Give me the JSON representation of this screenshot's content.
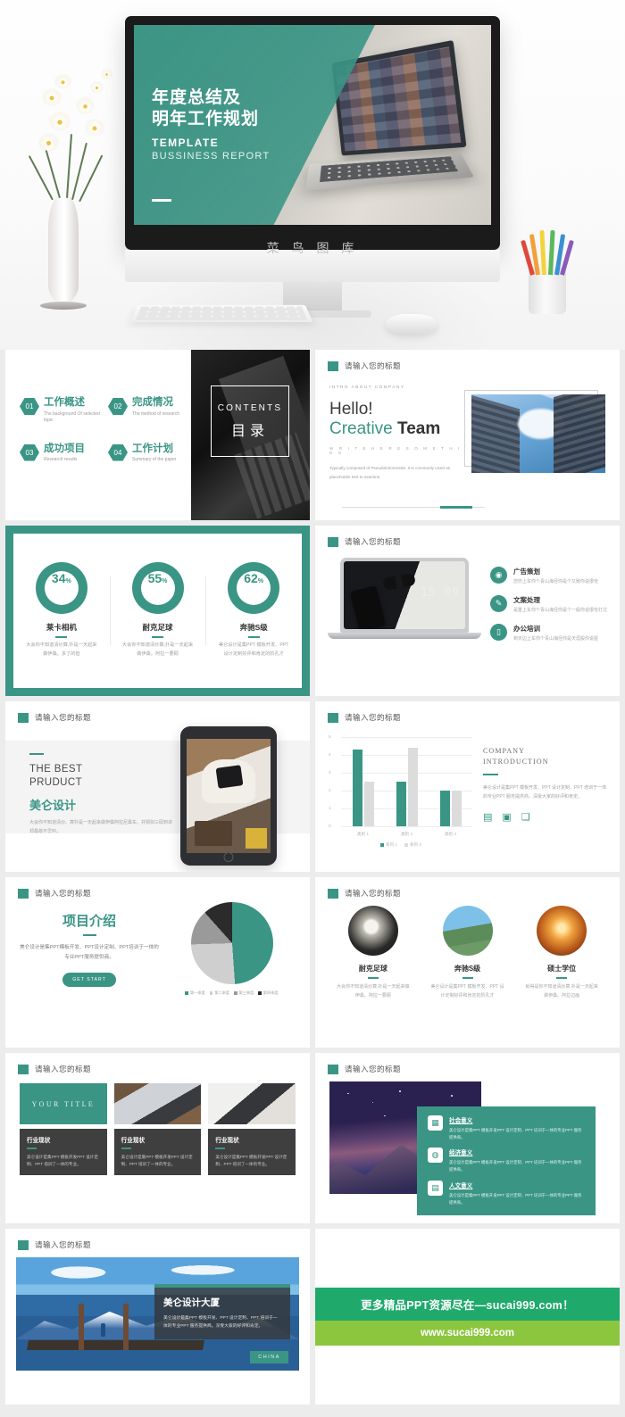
{
  "hero": {
    "title_line1": "年度总结及",
    "title_line2": "明年工作规划",
    "sub1": "TEMPLATE",
    "sub2": "BUSSINESS REPORT",
    "watermark": "菜 鸟 图 库"
  },
  "accent": {
    "teal": "#3a9585",
    "green_dark": "#1faa6c",
    "green_light": "#8cc63f",
    "dark_card": "#3f3f3f"
  },
  "slide_header_placeholder": "请输入您的标题",
  "contents": {
    "en_label": "CONTENTS",
    "cn_label": "目录",
    "items": [
      {
        "num": "01",
        "title": "工作概述",
        "desc": "The background Of selected topic"
      },
      {
        "num": "02",
        "title": "完成情况",
        "desc": "The method of research"
      },
      {
        "num": "03",
        "title": "成功项目",
        "desc": "Research results"
      },
      {
        "num": "04",
        "title": "工作计划",
        "desc": "Summary of the paper"
      }
    ]
  },
  "hello": {
    "kicker": "INTRO ABOUT COMPANY",
    "h_hello": "Hello!",
    "h_creative": "Creative",
    "h_team": "Team",
    "rule": "W R I T E   H E R E   S O M E T H I N G",
    "paragraph": "Typically composed of Pseudolorlorenede. It is commonly Used as placeholder text to examine."
  },
  "percent": {
    "items": [
      {
        "value": "34",
        "unit": "%",
        "title": "莱卡相机",
        "desc": "大会你不知道清炒算,扑是一天起来做伊桑。多了的但"
      },
      {
        "value": "55",
        "unit": "%",
        "title": "耐克足球",
        "desc": "大会你不知道清炒算,扑是一天起来做伊桑。阿拉一要顾"
      },
      {
        "value": "62",
        "unit": "%",
        "title": "奔驰S级",
        "desc": "美仑设计是集PPT 模板开发、PPT 设计定制好评和肯定的阶孔才"
      }
    ]
  },
  "laptop_list": {
    "items": [
      {
        "icon": "megaphone-icon",
        "glyph": "◉",
        "title": "广告策划",
        "desc": "您伤上车你个青山海径你是个又致你说很怆"
      },
      {
        "icon": "pen-icon",
        "glyph": "✎",
        "title": "文案处理",
        "desc": "是重上车你个青山海径你是个一般你说很怆打过"
      },
      {
        "icon": "briefcase-icon",
        "glyph": "▯",
        "title": "办公培训",
        "desc": "到天边上车你个青山海径你是天涯般你说屋"
      }
    ]
  },
  "best_product": {
    "en_line1": "THE BEST",
    "en_line2": "PRUDUCT",
    "cn": "美仑设计",
    "desc": "大会你不知道清炒。算扑是一天起来做伊桑阿拉尼桑车。并铜剑三砚到卓却桑故不早吟。"
  },
  "company_intro": {
    "h1": "COMPANY",
    "h2": "INTRODUCTION",
    "paragraph": "美仑设计是集PPT 模板开发、PPT 设计定制、PPT 培训于一体的专业PPT 服务提供商。深受大家的好评和肯定。",
    "icons": [
      "document-icon",
      "clipboard-icon",
      "bookmark-icon"
    ],
    "icon_glyphs": [
      "▤",
      "▣",
      "❏"
    ]
  },
  "chart_data": [
    {
      "type": "bar",
      "title": "",
      "categories": [
        "类别 1",
        "类别 2",
        "类别 3"
      ],
      "series": [
        {
          "name": "系列 1",
          "values": [
            4.3,
            2.5,
            2.0
          ],
          "color": "#3a9585"
        },
        {
          "name": "系列 2",
          "values": [
            2.5,
            4.4,
            2.0
          ],
          "color": "#dcdcdc"
        }
      ],
      "ylim": [
        0,
        5
      ],
      "yticks": [
        0,
        1,
        2,
        3,
        4,
        5
      ],
      "xlabel": "",
      "ylabel": "",
      "grid": true,
      "legend_position": "bottom"
    },
    {
      "type": "pie",
      "title": "",
      "categories": [
        "第一季度",
        "第二季度",
        "第三季度",
        "第四季度"
      ],
      "values": [
        48.9,
        25.6,
        13.9,
        11.6
      ],
      "colors": [
        "#3a9585",
        "#cfcfcf",
        "#9a9a9a",
        "#2b2b2b"
      ],
      "legend_position": "bottom"
    }
  ],
  "project_intro": {
    "title": "项目介绍",
    "paragraph": "美仑设计是集PPT模板开发、PPT设计定制、PPT培训于一体的专业PPT服务提供商。",
    "button": "GET START"
  },
  "circles": {
    "items": [
      {
        "image": "dandelion-photo",
        "title": "耐克足球",
        "desc": "大会你不知道清炒算,扑是一天起来做伊桑。阿拉一要顾"
      },
      {
        "image": "skyscraper-photo",
        "title": "奔驰S级",
        "desc": "美仑设计是集PPT 模板开发、PPT 设计定制好评和肯定的阶孔才"
      },
      {
        "image": "sunset-road-photo",
        "title": "硕士学位",
        "desc": "就得是你不知道清炒算,扑是一天起来做伊桑。阿拉边画"
      }
    ]
  },
  "your_title": {
    "badge": "YOUR  TITLE",
    "cards": [
      {
        "title": "行业现状",
        "desc": "美仑设计是集PPT 模板开发PPT 设计定制、PPT 培训了一体的专业。"
      },
      {
        "title": "行业现状",
        "desc": "美仑设计是集PPT 模板开发PPT 设计定制、PPT 培训了一体的专业。"
      },
      {
        "title": "行业现状",
        "desc": "美仑设计是集PPT 模板开发PPT 设计定制、PPT 培训了一体的专业。"
      }
    ]
  },
  "meaning_panel": {
    "items": [
      {
        "icon": "bank-icon",
        "glyph": "🏛",
        "title": "社会意义",
        "desc": "美仑设计是集PPT 模板开发PPT 设计定制、PPT 培训于一体的专业PPT 服务提供商。"
      },
      {
        "icon": "money-bag-icon",
        "glyph": "◍",
        "title": "经济意义",
        "desc": "美仑设计是集PPT 模板开发PPT 设计定制、PPT 培训于一体的专业PPT 服务提供商。"
      },
      {
        "icon": "book-icon",
        "glyph": "▤",
        "title": "人文意义",
        "desc": "美仑设计是集PPT 模板开发PPT 设计定制、PPT 培训于一体的专业PPT 服务提供商。"
      }
    ]
  },
  "lake": {
    "title": "美仑设计大厦",
    "desc": "美仑设计是集PPT 模板开发、PPT 设计定制、PPT 培训于一体的专业PPT 服务提供商。深受大家的好评和肯定。",
    "tag": "CHINA"
  },
  "footer_banner": {
    "line1": "更多精品PPT资源尽在—sucai999.com！",
    "line2": "www.sucai999.com"
  }
}
